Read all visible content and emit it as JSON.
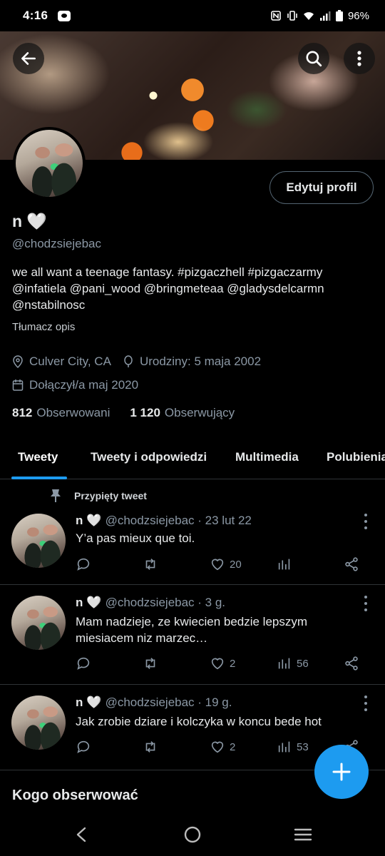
{
  "status_bar": {
    "time": "4:16",
    "battery": "96%"
  },
  "profile": {
    "name": "n",
    "name_emoji": "🤍",
    "handle": "@chodzsiejebac",
    "bio_line1": "we all want a teenage fantasy.  #pizgaczhell #pizgaczarmy",
    "bio_line2": "@infatiela @pani_wood @bringmeteaa @gladysdelcarmn",
    "bio_line3": "@nstabilnosc",
    "translate_label": "Tłumacz opis",
    "location": "Culver City, CA",
    "birthday": "Urodziny: 5 maja 2002",
    "joined": "Dołączył/a maj 2020",
    "following_count": "812",
    "following_label": "Obserwowani",
    "followers_count": "1 120",
    "followers_label": "Obserwujący",
    "edit_button": "Edytuj profil"
  },
  "tabs": [
    "Tweety",
    "Tweety i odpowiedzi",
    "Multimedia",
    "Polubienia"
  ],
  "pinned_label": "Przypięty tweet",
  "tweets": [
    {
      "name": "n",
      "emoji": "🤍",
      "handle_time": "@chodzsiejebac · 23 lut 22",
      "text": "Y’a pas mieux que toi.",
      "likes": "20",
      "views": ""
    },
    {
      "name": "n",
      "emoji": "🤍",
      "handle_time": "@chodzsiejebac · 3 g.",
      "text": "Mam nadzieje, ze kwiecien bedzie lepszym miesiacem niz marzec…",
      "likes": "2",
      "views": "56"
    },
    {
      "name": "n",
      "emoji": "🤍",
      "handle_time": "@chodzsiejebac · 19 g.",
      "text": "Jak zrobie dziare i kolczyka w koncu bede hot",
      "likes": "2",
      "views": "53"
    }
  ],
  "who_to_follow": "Kogo obserwować",
  "colors": {
    "accent": "#1d9bf0",
    "background": "#000000",
    "muted": "#8b98a5"
  }
}
